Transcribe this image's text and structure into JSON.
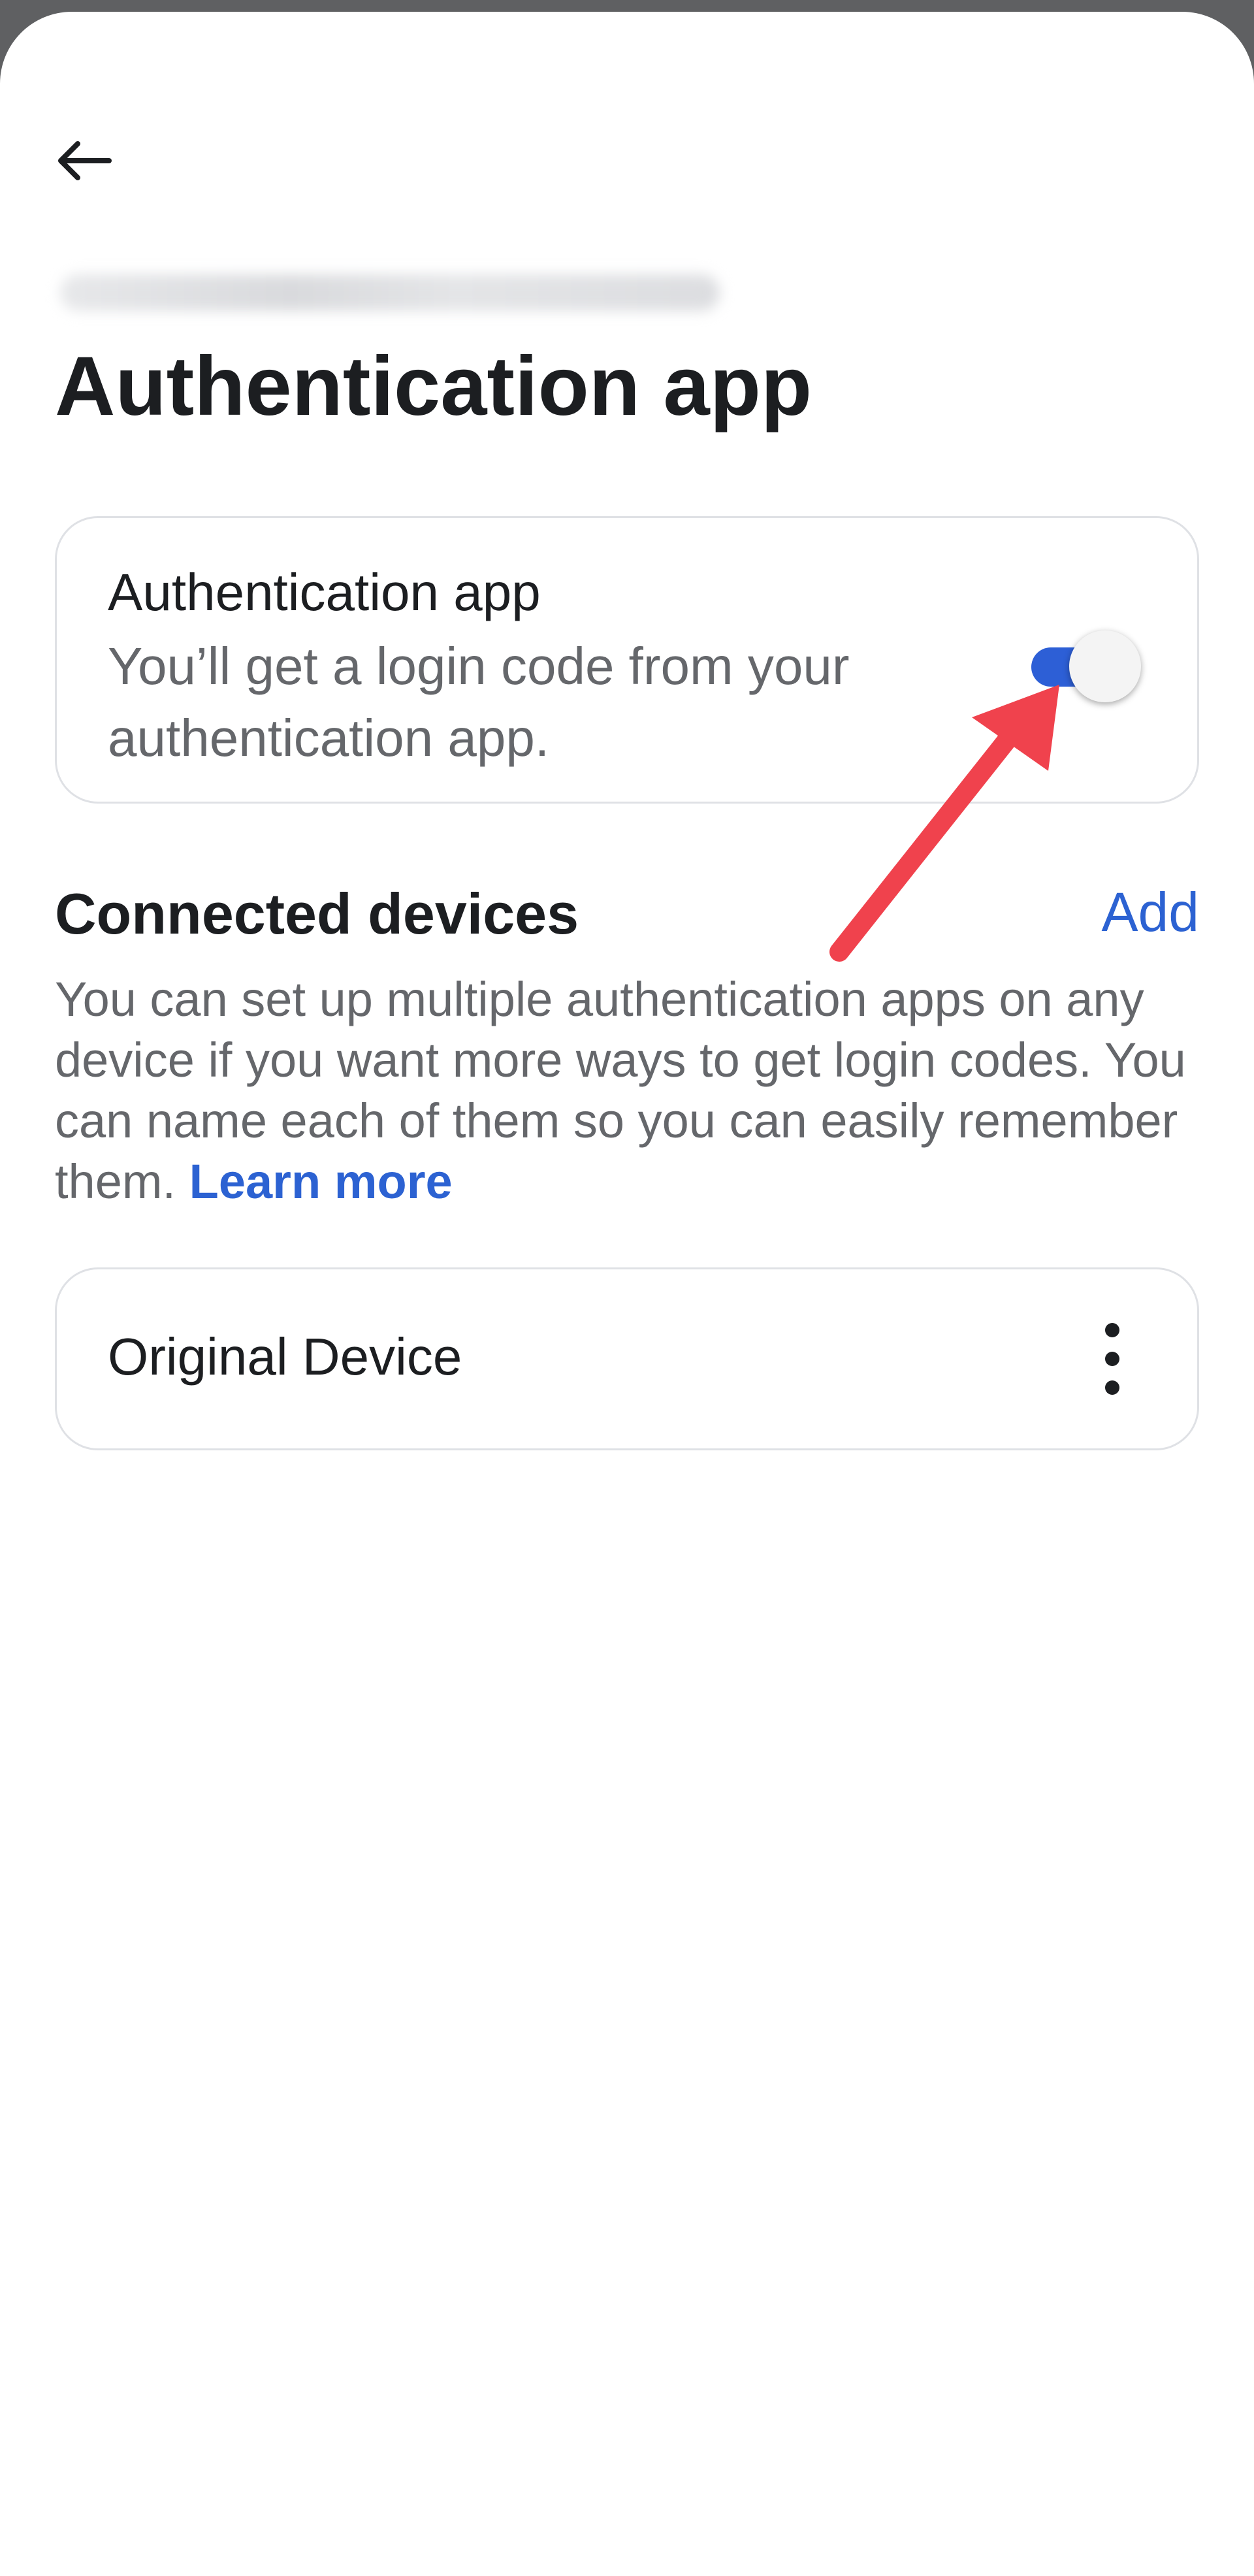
{
  "header": {
    "back_icon": "arrow-left-icon",
    "account_line": "redacted"
  },
  "page": {
    "title": "Authentication app"
  },
  "auth_card": {
    "title": "Authentication app",
    "description": "You’ll get a login code from your authentication app.",
    "toggle_on": true
  },
  "connected_devices": {
    "title": "Connected devices",
    "add_label": "Add",
    "description": "You can set up multiple authentication apps on any device if you want more ways to get login codes. You can name each of them so you can easily remember them.",
    "learn_more_label": "Learn more",
    "devices": [
      {
        "name": "Original Device",
        "menu_icon": "more-vertical-icon"
      }
    ]
  },
  "colors": {
    "accent": "#2c62d2",
    "toggle_track": "#2d5fd6",
    "annotation_arrow": "#f0424d",
    "text_primary": "#1c1e21",
    "text_secondary": "#65676b"
  }
}
